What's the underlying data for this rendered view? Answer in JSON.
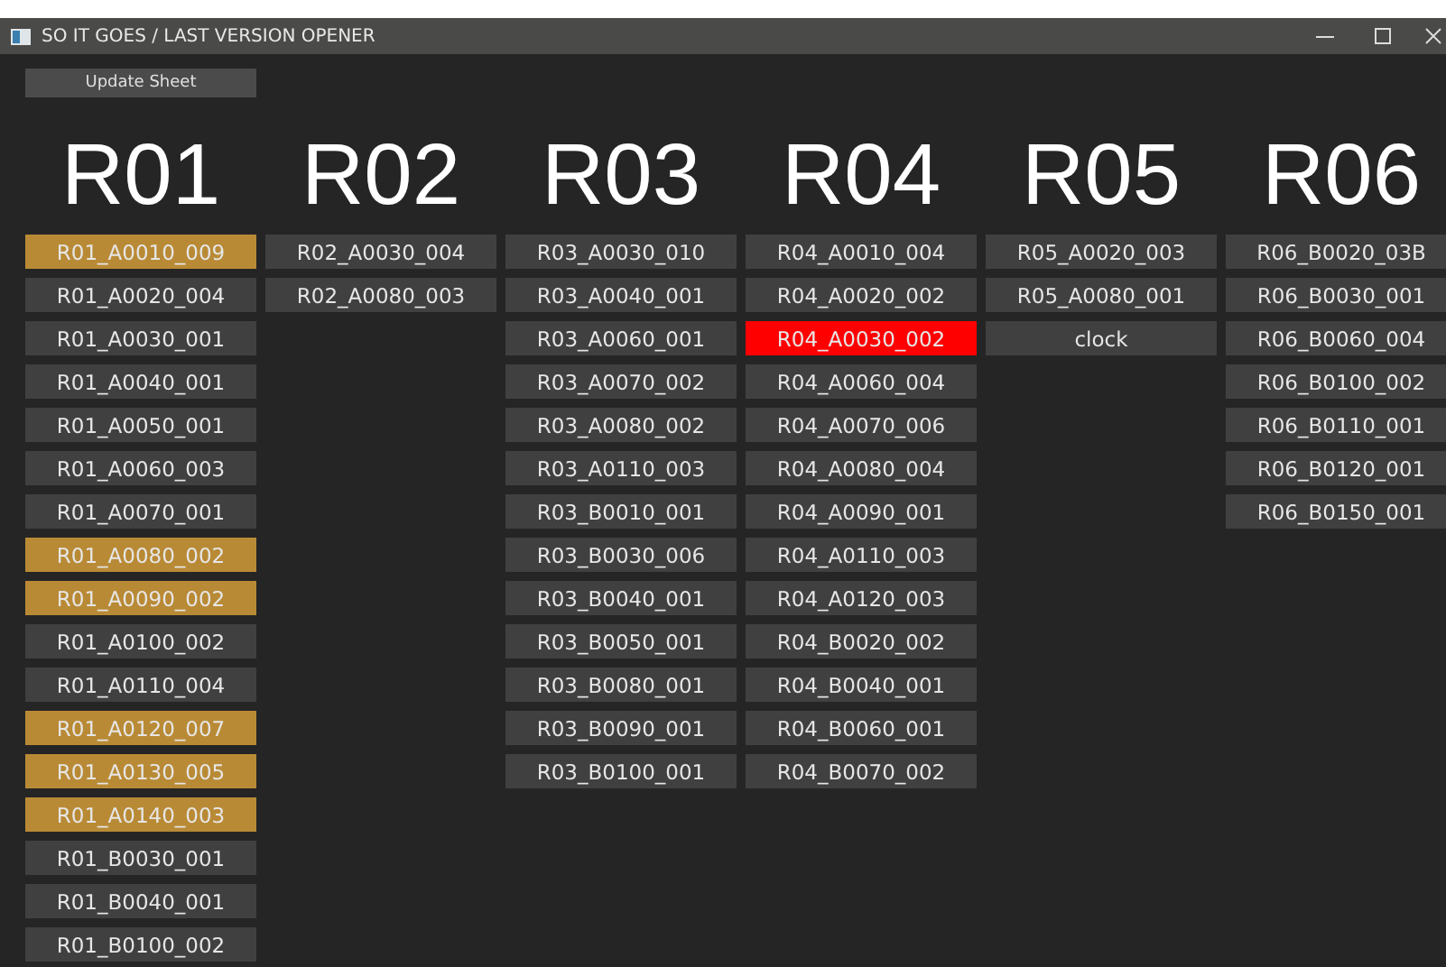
{
  "window": {
    "title": "SO IT GOES  / LAST VERSION OPENER"
  },
  "update_button": "Update Sheet",
  "columns": [
    {
      "header": "R01",
      "items": [
        {
          "label": "R01_A0010_009",
          "color": "#b98a35"
        },
        {
          "label": "R01_A0020_004",
          "color": "#404040"
        },
        {
          "label": "R01_A0030_001",
          "color": "#404040"
        },
        {
          "label": "R01_A0040_001",
          "color": "#404040"
        },
        {
          "label": "R01_A0050_001",
          "color": "#404040"
        },
        {
          "label": "R01_A0060_003",
          "color": "#404040"
        },
        {
          "label": "R01_A0070_001",
          "color": "#404040"
        },
        {
          "label": "R01_A0080_002",
          "color": "#b98a35"
        },
        {
          "label": "R01_A0090_002",
          "color": "#b98a35"
        },
        {
          "label": "R01_A0100_002",
          "color": "#404040"
        },
        {
          "label": "R01_A0110_004",
          "color": "#404040"
        },
        {
          "label": "R01_A0120_007",
          "color": "#b98a35"
        },
        {
          "label": "R01_A0130_005",
          "color": "#b98a35"
        },
        {
          "label": "R01_A0140_003",
          "color": "#b98a35"
        },
        {
          "label": "R01_B0030_001",
          "color": "#404040"
        },
        {
          "label": "R01_B0040_001",
          "color": "#404040"
        },
        {
          "label": "R01_B0100_002",
          "color": "#404040"
        }
      ]
    },
    {
      "header": "R02",
      "items": [
        {
          "label": "R02_A0030_004",
          "color": "#404040"
        },
        {
          "label": "R02_A0080_003",
          "color": "#404040"
        }
      ]
    },
    {
      "header": "R03",
      "items": [
        {
          "label": "R03_A0030_010",
          "color": "#404040"
        },
        {
          "label": "R03_A0040_001",
          "color": "#404040"
        },
        {
          "label": "R03_A0060_001",
          "color": "#404040"
        },
        {
          "label": "R03_A0070_002",
          "color": "#404040"
        },
        {
          "label": "R03_A0080_002",
          "color": "#404040"
        },
        {
          "label": "R03_A0110_003",
          "color": "#404040"
        },
        {
          "label": "R03_B0010_001",
          "color": "#404040"
        },
        {
          "label": "R03_B0030_006",
          "color": "#404040"
        },
        {
          "label": "R03_B0040_001",
          "color": "#404040"
        },
        {
          "label": "R03_B0050_001",
          "color": "#404040"
        },
        {
          "label": "R03_B0080_001",
          "color": "#404040"
        },
        {
          "label": "R03_B0090_001",
          "color": "#404040"
        },
        {
          "label": "R03_B0100_001",
          "color": "#404040"
        }
      ]
    },
    {
      "header": "R04",
      "items": [
        {
          "label": "R04_A0010_004",
          "color": "#404040"
        },
        {
          "label": "R04_A0020_002",
          "color": "#404040"
        },
        {
          "label": "R04_A0030_002",
          "color": "#ff0000"
        },
        {
          "label": "R04_A0060_004",
          "color": "#404040"
        },
        {
          "label": "R04_A0070_006",
          "color": "#404040"
        },
        {
          "label": "R04_A0080_004",
          "color": "#404040"
        },
        {
          "label": "R04_A0090_001",
          "color": "#404040"
        },
        {
          "label": "R04_A0110_003",
          "color": "#404040"
        },
        {
          "label": "R04_A0120_003",
          "color": "#404040"
        },
        {
          "label": "R04_B0020_002",
          "color": "#404040"
        },
        {
          "label": "R04_B0040_001",
          "color": "#404040"
        },
        {
          "label": "R04_B0060_001",
          "color": "#404040"
        },
        {
          "label": "R04_B0070_002",
          "color": "#404040"
        }
      ]
    },
    {
      "header": "R05",
      "items": [
        {
          "label": "R05_A0020_003",
          "color": "#404040"
        },
        {
          "label": "R05_A0080_001",
          "color": "#404040"
        },
        {
          "label": "clock",
          "color": "#404040"
        }
      ]
    },
    {
      "header": "R06",
      "items": [
        {
          "label": "R06_B0020_03B",
          "color": "#404040"
        },
        {
          "label": "R06_B0030_001",
          "color": "#404040"
        },
        {
          "label": "R06_B0060_004",
          "color": "#404040"
        },
        {
          "label": "R06_B0100_002",
          "color": "#404040"
        },
        {
          "label": "R06_B0110_001",
          "color": "#404040"
        },
        {
          "label": "R06_B0120_001",
          "color": "#404040"
        },
        {
          "label": "R06_B0150_001",
          "color": "#404040"
        }
      ]
    }
  ]
}
